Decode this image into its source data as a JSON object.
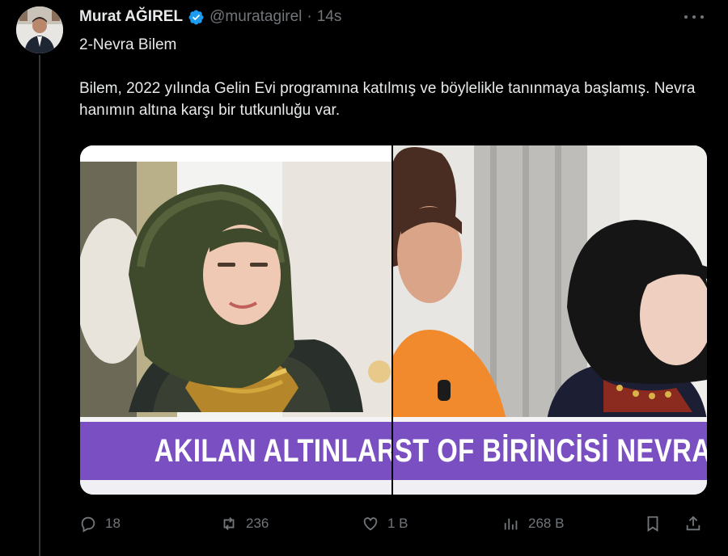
{
  "tweet": {
    "author_name": "Murat AĞIREL",
    "handle": "@muratagirel",
    "separator": "·",
    "time": "14s",
    "lines": [
      "2-Nevra Bilem",
      "Bilem, 2022 yılında Gelin Evi programına katılmış ve böylelikle tanınmaya başlamış. Nevra hanımın altına karşı bir tutkunluğu var."
    ],
    "media": {
      "left_caption": "AKILAN ALTINLARI SAYDI",
      "right_caption": "ST OF BİRİNCİSİ NEVRA G"
    }
  },
  "actions": {
    "replies": "18",
    "reposts": "236",
    "likes": "1 B",
    "views": "268 B"
  },
  "icons": {
    "more": "more-icon",
    "verified": "verified-badge-icon",
    "reply": "reply-icon",
    "repost": "repost-icon",
    "like": "heart-icon",
    "views": "views-chart-icon",
    "bookmark": "bookmark-icon",
    "share": "share-icon"
  },
  "colors": {
    "background": "#000000",
    "text": "#e7e9ea",
    "muted": "#71767b",
    "verified": "#1d9bf0",
    "banner_purple": "#7a4fc2"
  }
}
